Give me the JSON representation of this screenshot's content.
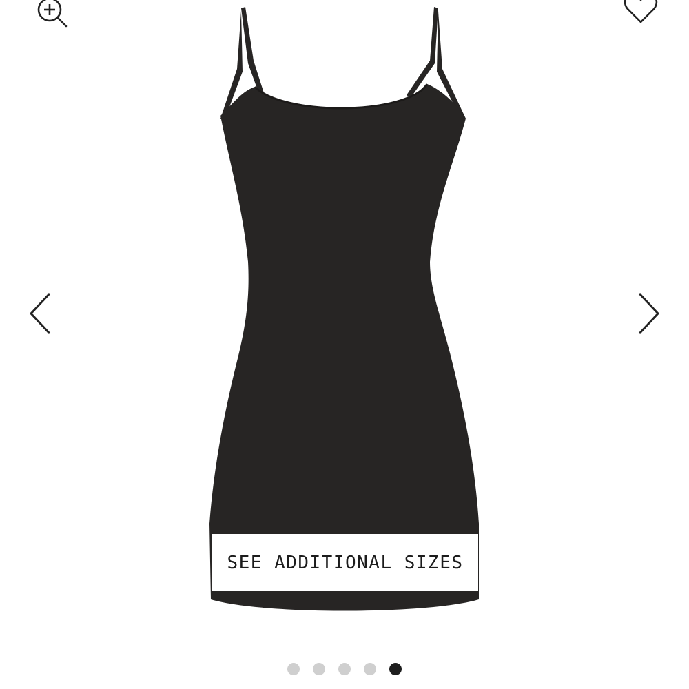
{
  "toolbar": {
    "zoom_icon": "zoom-in-icon",
    "wishlist_icon": "heart-outline-icon"
  },
  "carousel": {
    "prev_icon": "chevron-left-icon",
    "next_icon": "chevron-right-icon",
    "slide_count": 5,
    "active_index": 4
  },
  "product": {
    "image_subject": "black-dress",
    "sizes_label": "SEE ADDITIONAL SIZES"
  },
  "colors": {
    "dress": "#272524",
    "banner_text": "#1c1c1c",
    "dot_inactive": "#cfcfcf",
    "dot_active": "#1e1e1e",
    "icon_stroke": "#222222"
  }
}
